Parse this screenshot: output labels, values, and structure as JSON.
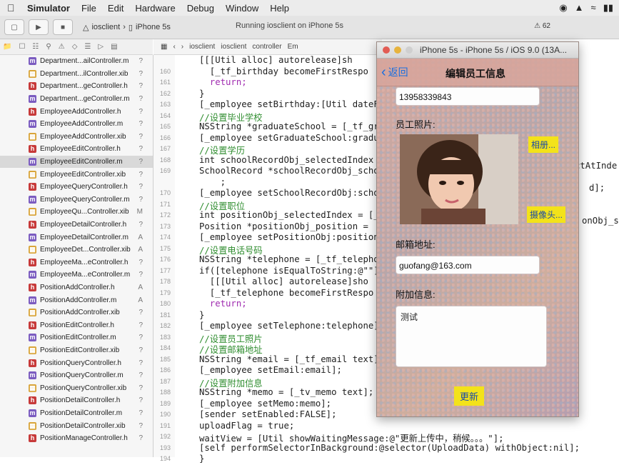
{
  "menubar": {
    "app_name": "Simulator",
    "items": [
      "File",
      "Edit",
      "Hardware",
      "Debug",
      "Window",
      "Help"
    ]
  },
  "toolbar": {
    "scheme": "iosclient",
    "device": "iPhone 5s",
    "running": "Running iosclient on iPhone 5s",
    "warnings": "62"
  },
  "jumpbar": {
    "items": [
      "iosclient",
      "iosclient",
      "controller",
      "Em"
    ]
  },
  "navigator": {
    "files": [
      {
        "name": "Department...ailController.m",
        "type": "m",
        "status": "?"
      },
      {
        "name": "Department...ilController.xib",
        "type": "x",
        "status": "?"
      },
      {
        "name": "Department...geController.h",
        "type": "h",
        "status": "?"
      },
      {
        "name": "Department...geController.m",
        "type": "m",
        "status": "?"
      },
      {
        "name": "EmployeeAddController.h",
        "type": "h",
        "status": "?"
      },
      {
        "name": "EmployeeAddController.m",
        "type": "m",
        "status": "?"
      },
      {
        "name": "EmployeeAddController.xib",
        "type": "x",
        "status": "?"
      },
      {
        "name": "EmployeeEditController.h",
        "type": "h",
        "status": "?"
      },
      {
        "name": "EmployeeEditController.m",
        "type": "m",
        "status": "?"
      },
      {
        "name": "EmployeeEditController.xib",
        "type": "x",
        "status": "?"
      },
      {
        "name": "EmployeeQueryController.h",
        "type": "h",
        "status": "?"
      },
      {
        "name": "EmployeeQueryController.m",
        "type": "m",
        "status": "?"
      },
      {
        "name": "EmployeeQu...Controller.xib",
        "type": "x",
        "status": "M"
      },
      {
        "name": "EmployeeDetailController.h",
        "type": "h",
        "status": "?"
      },
      {
        "name": "EmployeeDetailController.m",
        "type": "m",
        "status": "A"
      },
      {
        "name": "EmployeeDet...Controller.xib",
        "type": "x",
        "status": "A"
      },
      {
        "name": "EmployeeMa...eController.h",
        "type": "h",
        "status": "?"
      },
      {
        "name": "EmployeeMa...eController.m",
        "type": "m",
        "status": "?"
      },
      {
        "name": "PositionAddController.h",
        "type": "h",
        "status": "A"
      },
      {
        "name": "PositionAddController.m",
        "type": "m",
        "status": "A"
      },
      {
        "name": "PositionAddController.xib",
        "type": "x",
        "status": "?"
      },
      {
        "name": "PositionEditController.h",
        "type": "h",
        "status": "?"
      },
      {
        "name": "PositionEditController.m",
        "type": "m",
        "status": "?"
      },
      {
        "name": "PositionEditController.xib",
        "type": "x",
        "status": "?"
      },
      {
        "name": "PositionQueryController.h",
        "type": "h",
        "status": "?"
      },
      {
        "name": "PositionQueryController.m",
        "type": "m",
        "status": "?"
      },
      {
        "name": "PositionQueryController.xib",
        "type": "x",
        "status": "?"
      },
      {
        "name": "PositionDetailController.h",
        "type": "h",
        "status": "?"
      },
      {
        "name": "PositionDetailController.m",
        "type": "m",
        "status": "?"
      },
      {
        "name": "PositionDetailController.xib",
        "type": "x",
        "status": "?"
      },
      {
        "name": "PositionManageController.h",
        "type": "h",
        "status": "?"
      }
    ],
    "selected_index": 8
  },
  "editor": {
    "lines": [
      {
        "n": "",
        "t": "[[[Util alloc] autorelease]sh",
        "k": "code"
      },
      {
        "n": "160",
        "t": "  [_tf_birthday becomeFirstRespo",
        "k": "code"
      },
      {
        "n": "161",
        "t": "  return;",
        "k": "kw"
      },
      {
        "n": "162",
        "t": "}",
        "k": "code"
      },
      {
        "n": "163",
        "t": "[_employee setBirthday:[Util dateF",
        "k": "code"
      },
      {
        "n": "164",
        "t": "//设置毕业学校",
        "k": "comment"
      },
      {
        "n": "165",
        "t": "NSString *graduateSchool = [_tf_gr",
        "k": "code"
      },
      {
        "n": "166",
        "t": "[_employee setGraduateSchool:gradu",
        "k": "code"
      },
      {
        "n": "167",
        "t": "//设置学历",
        "k": "comment"
      },
      {
        "n": "168",
        "t": "int schoolRecordObj_selectedIndex",
        "k": "code"
      },
      {
        "n": "169",
        "t": "SchoolRecord *schoolRecordObj_scho",
        "k": "code"
      },
      {
        "n": "",
        "t": "    ;",
        "k": "code"
      },
      {
        "n": "170",
        "t": "[_employee setSchoolRecordObj:scho",
        "k": "code"
      },
      {
        "n": "171",
        "t": "//设置职位",
        "k": "comment"
      },
      {
        "n": "172",
        "t": "int positionObj_selectedIndex = [_",
        "k": "code"
      },
      {
        "n": "173",
        "t": "Position *positionObj_position = ",
        "k": "code"
      },
      {
        "n": "174",
        "t": "[_employee setPositionObj:position",
        "k": "code"
      },
      {
        "n": "175",
        "t": "//设置电话号码",
        "k": "comment"
      },
      {
        "n": "176",
        "t": "NSString *telephone = [_tf_telepho",
        "k": "code"
      },
      {
        "n": "177",
        "t": "if([telephone isEqualToString:@\"\"]",
        "k": "code"
      },
      {
        "n": "178",
        "t": "  [[[Util alloc] autorelease]sho",
        "k": "code"
      },
      {
        "n": "179",
        "t": "  [_tf_telephone becomeFirstRespo",
        "k": "code"
      },
      {
        "n": "180",
        "t": "  return;",
        "k": "kw"
      },
      {
        "n": "181",
        "t": "}",
        "k": "code"
      },
      {
        "n": "182",
        "t": "[_employee setTelephone:telephone]",
        "k": "code"
      },
      {
        "n": "183",
        "t": "//设置员工照片",
        "k": "comment"
      },
      {
        "n": "184",
        "t": "//设置邮箱地址",
        "k": "comment"
      },
      {
        "n": "185",
        "t": "NSString *email = [_tf_email text];",
        "k": "code"
      },
      {
        "n": "186",
        "t": "[_employee setEmail:email];",
        "k": "code"
      },
      {
        "n": "187",
        "t": "//设置附加信息",
        "k": "comment"
      },
      {
        "n": "188",
        "t": "NSString *memo = [_tv_memo text];",
        "k": "code"
      },
      {
        "n": "189",
        "t": "[_employee setMemo:memo];",
        "k": "code"
      },
      {
        "n": "190",
        "t": "[sender setEnabled:FALSE];",
        "k": "code"
      },
      {
        "n": "191",
        "t": "uploadFlag = true;",
        "k": "code"
      },
      {
        "n": "192",
        "t": "waitView = [Util showWaitingMessage:@\"更新上传中，稍候。。。\"];",
        "k": "code"
      },
      {
        "n": "193",
        "t": "[self performSelectorInBackground:@selector(UploadData) withObject:nil];",
        "k": "code"
      },
      {
        "n": "194",
        "t": "}",
        "k": "code"
      }
    ],
    "right_fragments": [
      "ctAtInde",
      "d];",
      "onObj_se"
    ]
  },
  "simulator": {
    "window_title": "iPhone 5s - iPhone 5s / iOS 9.0 (13A...",
    "back_label": "返回",
    "title": "编辑员工信息",
    "phone_value": "13958339843",
    "photo_label": "员工照片:",
    "album_button": "相册...",
    "camera_button": "摄像头...",
    "email_label": "邮箱地址:",
    "email_value": "guofang@163.com",
    "memo_label": "附加信息:",
    "memo_value": "测试",
    "update_button": "更新"
  }
}
